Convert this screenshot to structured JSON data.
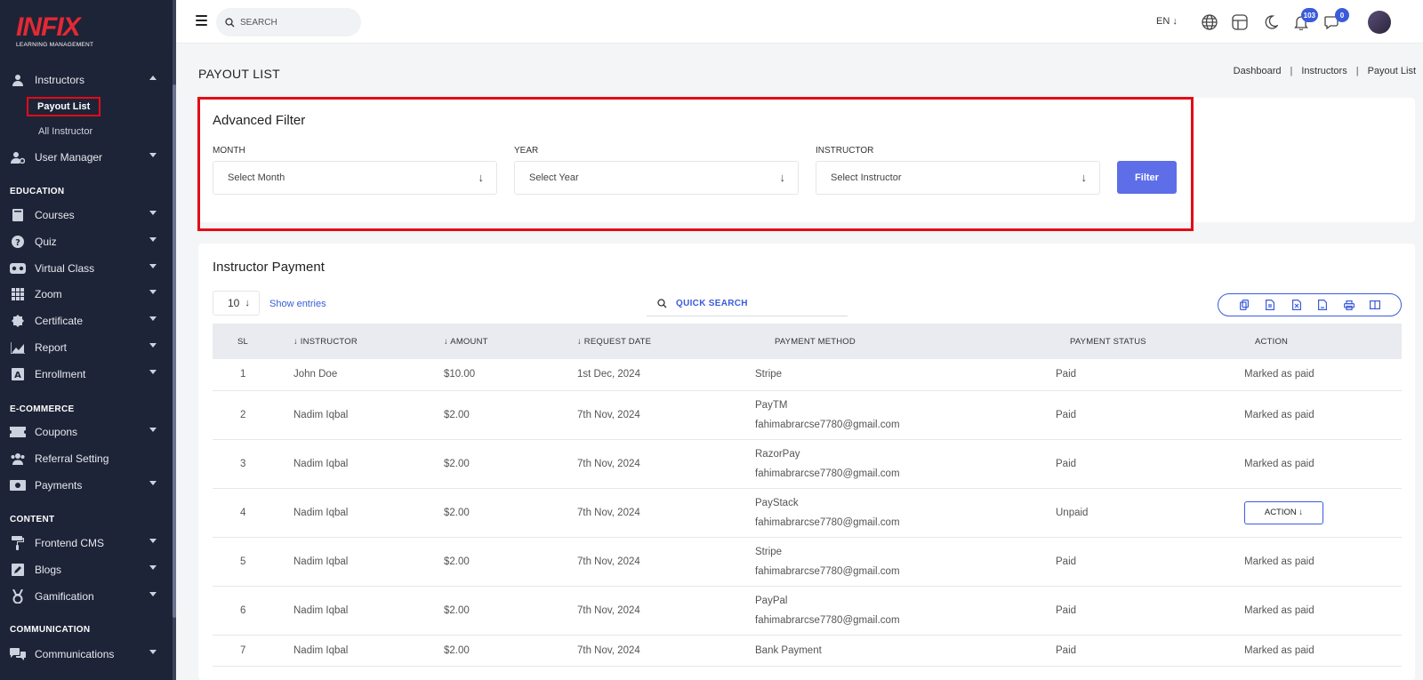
{
  "app": {
    "logo_text": "INFIX",
    "logo_sub": "LEARNING MANAGEMENT"
  },
  "sidebar": {
    "instructors": "Instructors",
    "payout_list": "Payout List",
    "all_instructor": "All Instructor",
    "user_manager": "User Manager",
    "section_education": "EDUCATION",
    "courses": "Courses",
    "quiz": "Quiz",
    "virtual_class": "Virtual Class",
    "zoom": "Zoom",
    "certificate": "Certificate",
    "report": "Report",
    "enrollment": "Enrollment",
    "section_ecommerce": "E-COMMERCE",
    "coupons": "Coupons",
    "referral_setting": "Referral Setting",
    "payments": "Payments",
    "section_content": "CONTENT",
    "frontend_cms": "Frontend CMS",
    "blogs": "Blogs",
    "gamification": "Gamification",
    "section_communication": "COMMUNICATION",
    "communications": "Communications"
  },
  "topbar": {
    "search_placeholder": "SEARCH",
    "language": "EN",
    "notification_count": "103",
    "message_count": "0"
  },
  "page": {
    "title": "PAYOUT LIST",
    "breadcrumb": [
      "Dashboard",
      "Instructors",
      "Payout List"
    ]
  },
  "filter": {
    "title": "Advanced Filter",
    "month_label": "MONTH",
    "month_value": "Select Month",
    "year_label": "YEAR",
    "year_value": "Select Year",
    "instructor_label": "INSTRUCTOR",
    "instructor_value": "Select Instructor",
    "button": "Filter"
  },
  "payment": {
    "title": "Instructor Payment",
    "entries": "10",
    "show_entries": "Show entries",
    "quick_search_placeholder": "QUICK SEARCH",
    "columns": {
      "sl": "SL",
      "instructor": "INSTRUCTOR",
      "amount": "AMOUNT",
      "request_date": "REQUEST DATE",
      "payment_method": "PAYMENT METHOD",
      "payment_status": "PAYMENT STATUS",
      "action": "ACTION"
    },
    "rows": [
      {
        "sl": "1",
        "instructor": "John Doe",
        "amount": "$10.00",
        "date": "1st Dec, 2024",
        "method": "Stripe",
        "email": "",
        "status": "Paid",
        "action": "Marked as paid"
      },
      {
        "sl": "2",
        "instructor": "Nadim Iqbal",
        "amount": "$2.00",
        "date": "7th Nov, 2024",
        "method": "PayTM",
        "email": "fahimabrarcse7780@gmail.com",
        "status": "Paid",
        "action": "Marked as paid"
      },
      {
        "sl": "3",
        "instructor": "Nadim Iqbal",
        "amount": "$2.00",
        "date": "7th Nov, 2024",
        "method": "RazorPay",
        "email": "fahimabrarcse7780@gmail.com",
        "status": "Paid",
        "action": "Marked as paid"
      },
      {
        "sl": "4",
        "instructor": "Nadim Iqbal",
        "amount": "$2.00",
        "date": "7th Nov, 2024",
        "method": "PayStack",
        "email": "fahimabrarcse7780@gmail.com",
        "status": "Unpaid",
        "action": "ACTION"
      },
      {
        "sl": "5",
        "instructor": "Nadim Iqbal",
        "amount": "$2.00",
        "date": "7th Nov, 2024",
        "method": "Stripe",
        "email": "fahimabrarcse7780@gmail.com",
        "status": "Paid",
        "action": "Marked as paid"
      },
      {
        "sl": "6",
        "instructor": "Nadim Iqbal",
        "amount": "$2.00",
        "date": "7th Nov, 2024",
        "method": "PayPal",
        "email": "fahimabrarcse7780@gmail.com",
        "status": "Paid",
        "action": "Marked as paid"
      },
      {
        "sl": "7",
        "instructor": "Nadim Iqbal",
        "amount": "$2.00",
        "date": "7th Nov, 2024",
        "method": "Bank Payment",
        "email": "",
        "status": "Paid",
        "action": "Marked as paid"
      }
    ]
  },
  "colors": {
    "sidebar_bg": "#1e2437",
    "accent": "#3b5bdb",
    "filter_button": "#5e6ee8",
    "highlight": "#e30b17",
    "logo_red": "#e32934"
  }
}
